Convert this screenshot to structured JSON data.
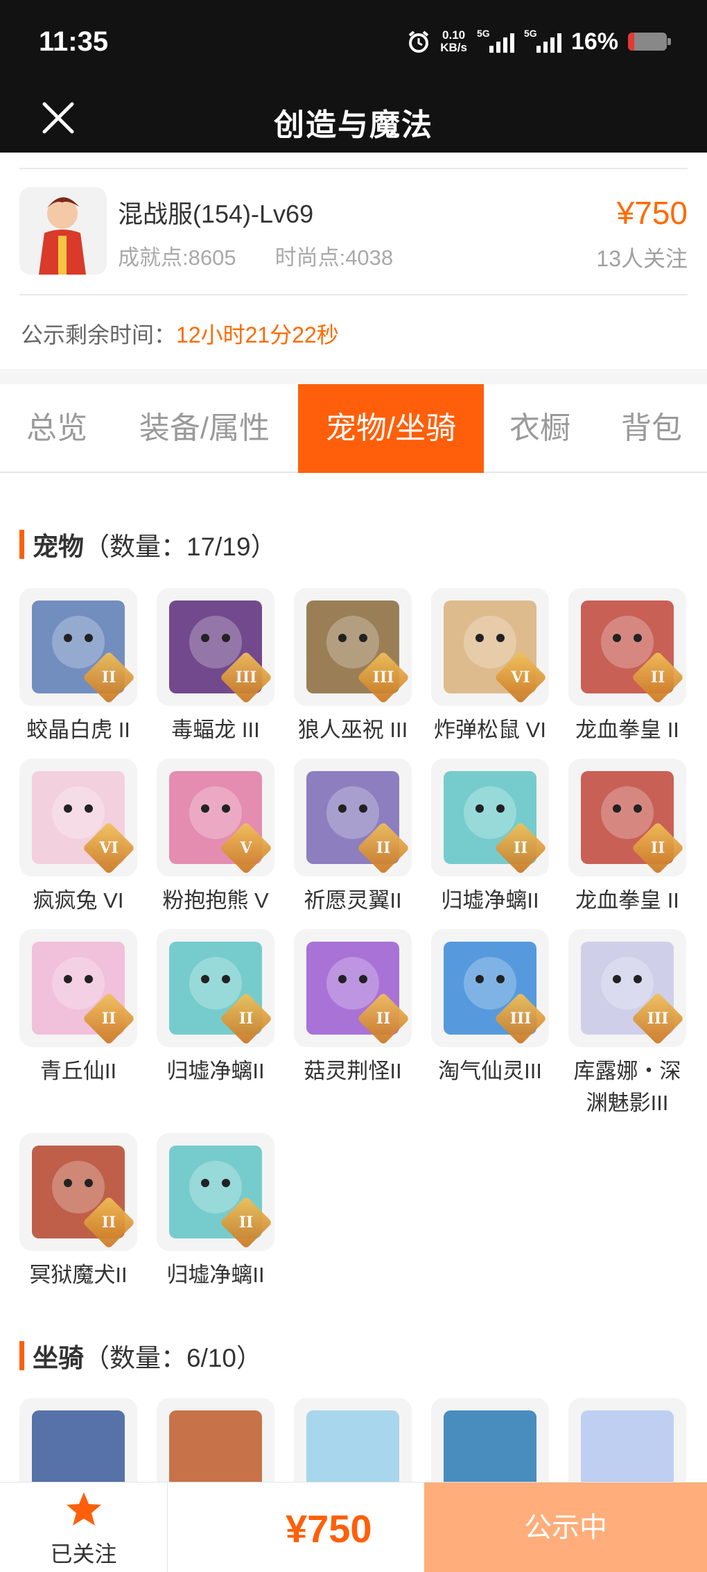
{
  "status_bar": {
    "time": "11:35",
    "net_speed_value": "0.10",
    "net_speed_unit": "KB/s",
    "signal1": "5G",
    "signal2": "5G",
    "battery": "16%"
  },
  "navbar": {
    "title": "创造与魔法"
  },
  "product": {
    "name": "混战服(154)-Lv69",
    "achievement": "成就点:8605",
    "fashion": "时尚点:4038",
    "price": "¥750",
    "followers": "13人关注"
  },
  "notice": {
    "label": "公示剩余时间：",
    "value": "12小时21分22秒"
  },
  "tabs": [
    "总览",
    "装备/属性",
    "宠物/坐骑",
    "衣橱",
    "背包"
  ],
  "active_tab": "宠物/坐骑",
  "pets": {
    "title": "宠物",
    "count": "（数量：17/19）",
    "items": [
      {
        "name": "蛟晶白虎 II",
        "rank": "II",
        "color": "#5b7bb5"
      },
      {
        "name": "毒蝠龙 III",
        "rank": "III",
        "color": "#5a2a7a"
      },
      {
        "name": "狼人巫祝 III",
        "rank": "III",
        "color": "#8a6a3a"
      },
      {
        "name": "炸弹松鼠 VI",
        "rank": "VI",
        "color": "#d9b07a"
      },
      {
        "name": "龙血拳皇 II",
        "rank": "II",
        "color": "#c0453a"
      },
      {
        "name": "疯疯兔 VI",
        "rank": "VI",
        "color": "#f2c9d9"
      },
      {
        "name": "粉抱抱熊 V",
        "rank": "V",
        "color": "#e07aa5"
      },
      {
        "name": "祈愿灵翼II",
        "rank": "II",
        "color": "#7a6ab5"
      },
      {
        "name": "归墟净螭II",
        "rank": "II",
        "color": "#5fc4c4"
      },
      {
        "name": "龙血拳皇 II",
        "rank": "II",
        "color": "#c0453a"
      },
      {
        "name": "青丘仙II",
        "rank": "II",
        "color": "#f0b6d6"
      },
      {
        "name": "归墟净螭II",
        "rank": "II",
        "color": "#5fc4c4"
      },
      {
        "name": "菇灵荆怪II",
        "rank": "II",
        "color": "#9a5ad0"
      },
      {
        "name": "淘气仙灵III",
        "rank": "III",
        "color": "#3a8ad8"
      },
      {
        "name": "库露娜・深渊魅影III",
        "rank": "III",
        "color": "#c8c8e8"
      },
      {
        "name": "冥狱魔犬II",
        "rank": "II",
        "color": "#b5442a"
      },
      {
        "name": "归墟净螭II",
        "rank": "II",
        "color": "#5fc4c4"
      }
    ]
  },
  "mounts": {
    "title": "坐骑",
    "count": "（数量：6/10）",
    "items": [
      {
        "color": "#3a5a9a"
      },
      {
        "color": "#c05a2a"
      },
      {
        "color": "#9ad0ea"
      },
      {
        "color": "#2a7ab5"
      },
      {
        "color": "#b5c8f0"
      }
    ]
  },
  "bottom_bar": {
    "follow_label": "已关注",
    "price": "¥750",
    "status": "公示中"
  },
  "colors": {
    "accent": "#ff5f0a",
    "price": "#ff6a00",
    "dark_bar": "#121212"
  }
}
